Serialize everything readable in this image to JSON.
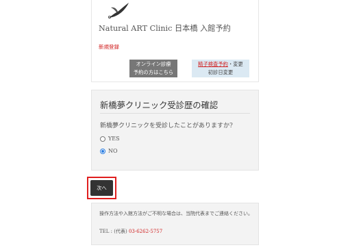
{
  "header": {
    "clinic_title": "Natural ART Clinic 日本橋 入館予約",
    "new_register": "新規登録",
    "online_button_line1": "オンライン診療",
    "online_button_line2": "予約の方はこちら",
    "sperm_test_link": "精子検査予約",
    "sperm_test_suffix": "・変更",
    "first_visit_change": "初診日変更"
  },
  "question": {
    "title": "新橋夢クリニック受診歴の確認",
    "text": "新橋夢クリニックを受診したことがありますか?",
    "options": [
      {
        "label": "YES",
        "checked": false
      },
      {
        "label": "NO",
        "checked": true
      }
    ]
  },
  "next_button": "次へ",
  "info": {
    "text": "操作方法や入館方法がご不明な場合は、当院代表までご連絡ください。",
    "tel_prefix": "TEL : (代表) ",
    "tel_number": "03-6262-5757"
  },
  "colors": {
    "accent_red": "#d02020",
    "highlight_border": "#e01e1e",
    "radio_selected": "#2a7de1"
  }
}
